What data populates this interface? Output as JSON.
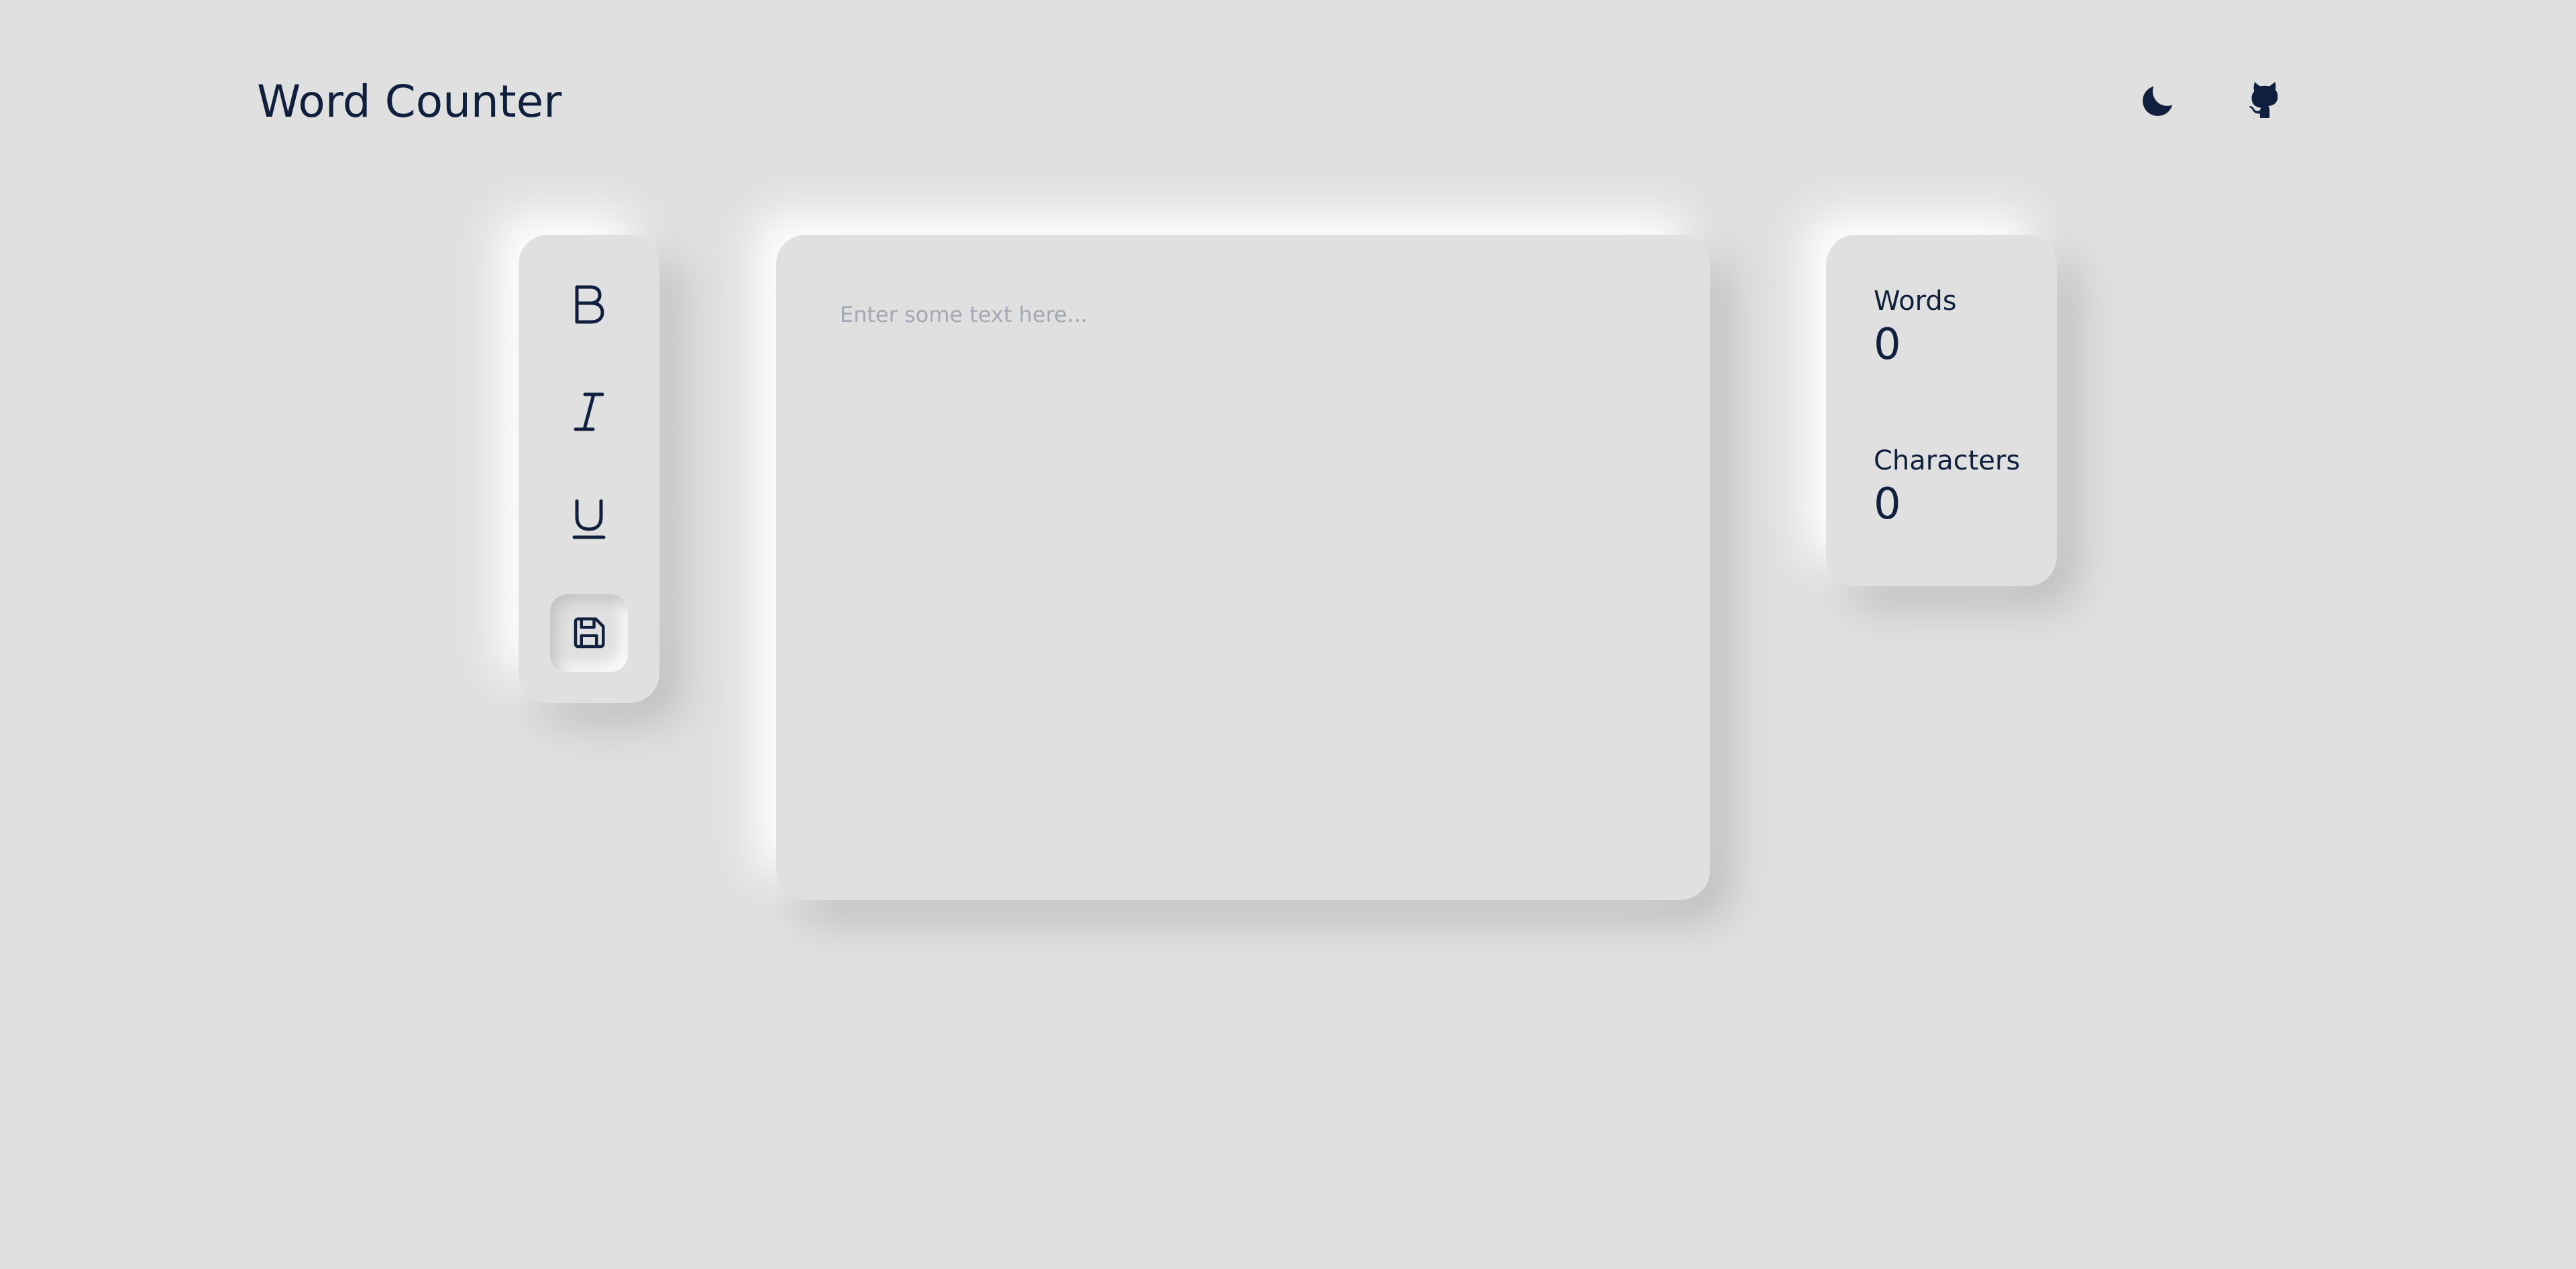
{
  "header": {
    "title": "Word Counter",
    "theme_toggle_icon": "moon-icon",
    "github_icon": "github-icon"
  },
  "toolbar": {
    "bold_icon": "bold-icon",
    "italic_icon": "italic-icon",
    "underline_icon": "underline-icon",
    "save_icon": "save-icon",
    "save_active": true
  },
  "editor": {
    "value": "",
    "placeholder": "Enter some text here..."
  },
  "stats": {
    "words": {
      "label": "Words",
      "value": "0"
    },
    "characters": {
      "label": "Characters",
      "value": "0"
    }
  },
  "colors": {
    "background": "#e0e0e0",
    "text": "#0f1f3d",
    "placeholder": "#a3a8b4"
  }
}
